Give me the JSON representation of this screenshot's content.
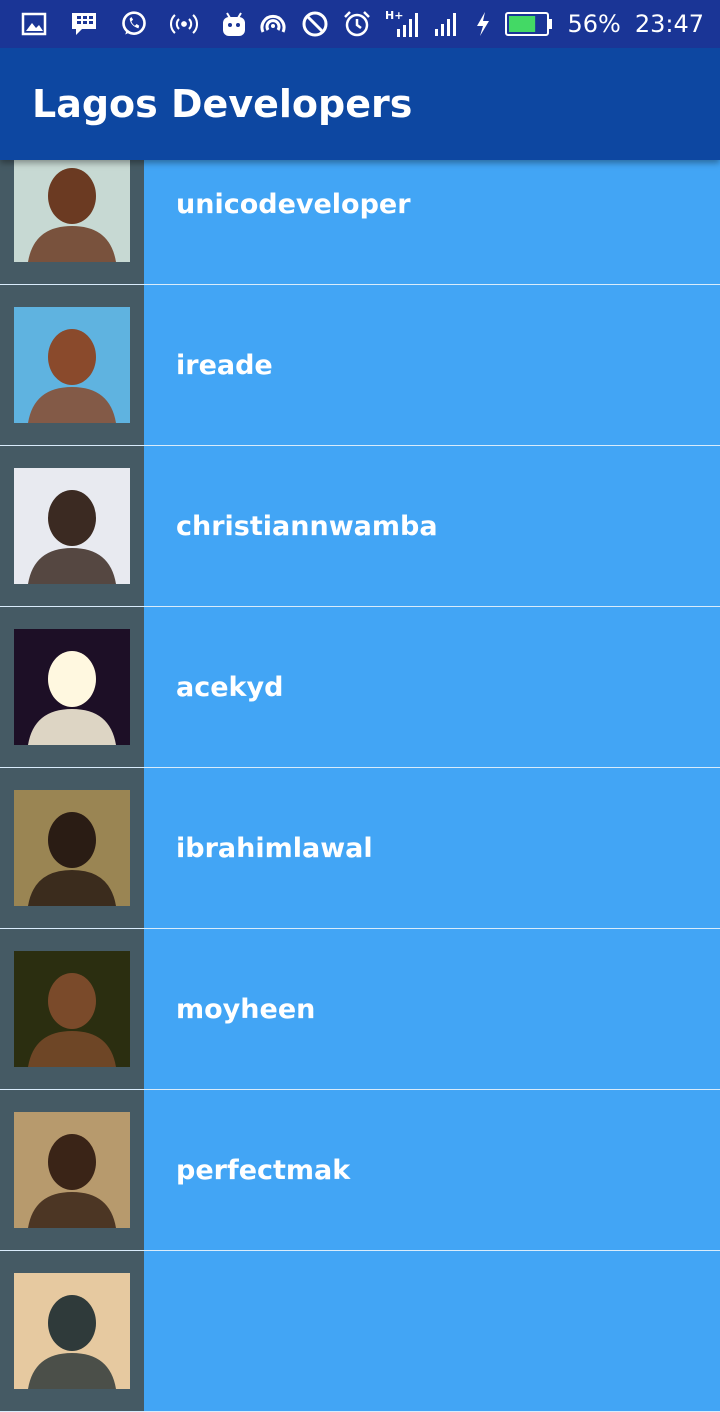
{
  "status_bar": {
    "battery_percent": "56%",
    "time": "23:47",
    "battery_level": 0.56,
    "icons": [
      "gallery-icon",
      "bbm-icon",
      "whatsapp-icon",
      "hotspot-icon",
      "android-icon",
      "nfc-icon",
      "block-icon",
      "alarm-icon",
      "signal-hplus-icon",
      "signal-icon",
      "charging-icon",
      "battery-icon"
    ]
  },
  "app_bar": {
    "title": "Lagos Developers"
  },
  "developers": [
    {
      "login": "unicodeveloper",
      "avatar_colors": [
        "#c7d9d3",
        "#6b3a22"
      ]
    },
    {
      "login": "ireade",
      "avatar_colors": [
        "#5fb3e0",
        "#8a4a2c"
      ]
    },
    {
      "login": "christiannwamba",
      "avatar_colors": [
        "#e8eaf0",
        "#3b2a22"
      ]
    },
    {
      "login": "acekyd",
      "avatar_colors": [
        "#1d0f26",
        "#fff8e0"
      ]
    },
    {
      "login": "ibrahimlawal",
      "avatar_colors": [
        "#9a8553",
        "#2a1c14"
      ]
    },
    {
      "login": "moyheen",
      "avatar_colors": [
        "#2b2e10",
        "#7a4a2a"
      ]
    },
    {
      "login": "perfectmak",
      "avatar_colors": [
        "#b79a6d",
        "#3a2417"
      ]
    },
    {
      "login": "",
      "avatar_colors": [
        "#e6c9a0",
        "#2f3a3a"
      ]
    }
  ],
  "colors": {
    "status_bar": "#1a3596",
    "app_bar": "#0d47a1",
    "row_right": "#42a5f5",
    "row_left": "#455a64"
  }
}
